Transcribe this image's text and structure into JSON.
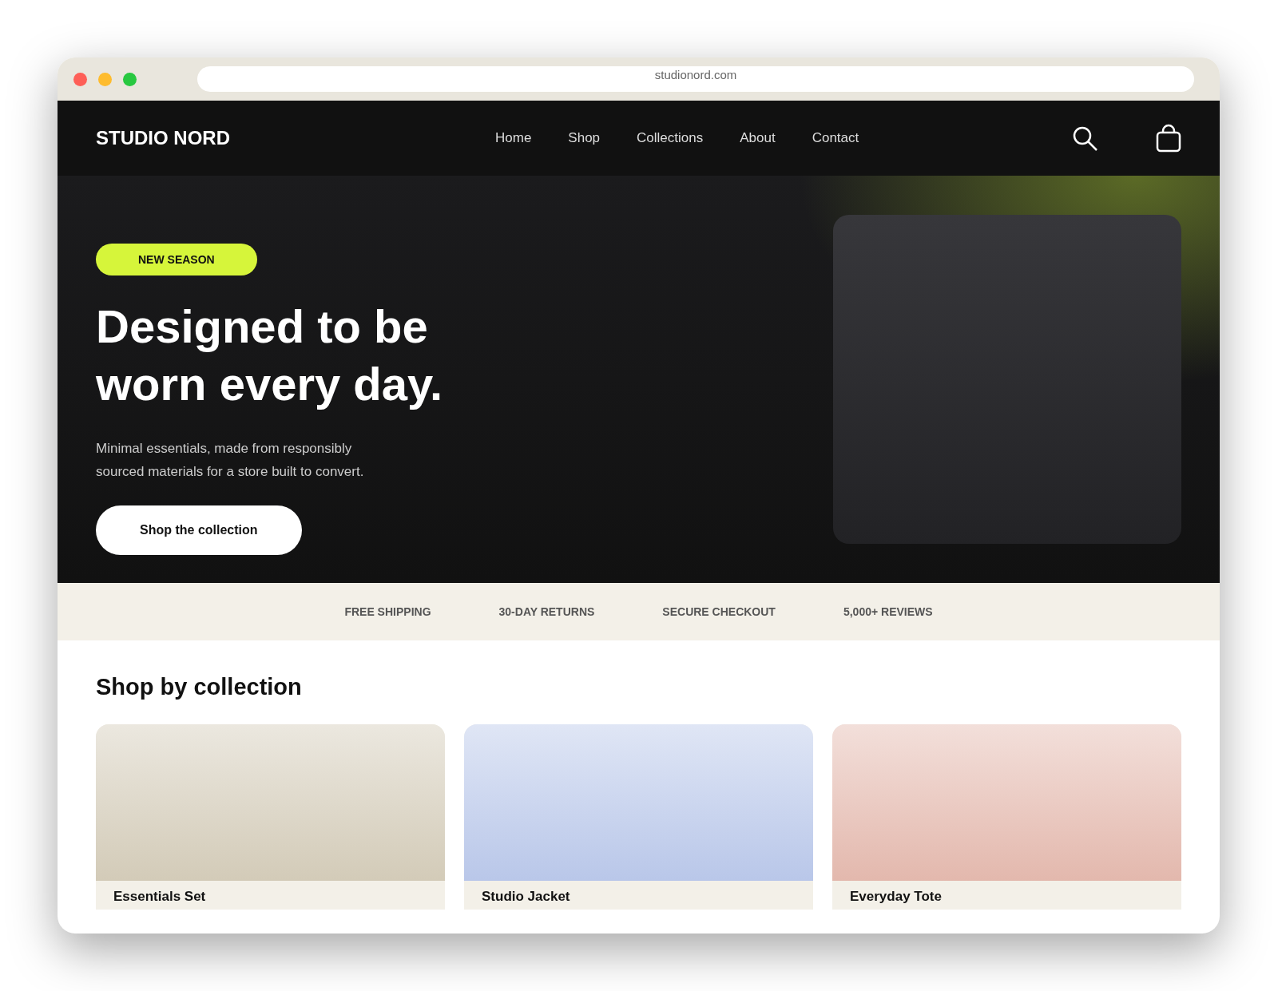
{
  "browser": {
    "url": "studionord.com"
  },
  "nav": {
    "logo": "STUDIO NORD",
    "links": [
      {
        "label": "Home"
      },
      {
        "label": "Shop"
      },
      {
        "label": "Collections"
      },
      {
        "label": "About"
      },
      {
        "label": "Contact"
      }
    ]
  },
  "hero": {
    "badge": "NEW SEASON",
    "title": "Designed to be worn every day.",
    "subtitle": "Minimal essentials, made from responsibly sourced materials for a store built to convert.",
    "button": "Shop the collection"
  },
  "trust_bar": [
    "FREE SHIPPING",
    "30-DAY RETURNS",
    "SECURE CHECKOUT",
    "5,000+ REVIEWS"
  ],
  "collections": {
    "heading": "Shop by collection",
    "cards": [
      {
        "title": "Essentials Set",
        "color": "#d3cbb8"
      },
      {
        "title": "Studio Jacket",
        "color": "#b9c7e9"
      },
      {
        "title": "Everyday Tote",
        "color": "#e3b8ad"
      }
    ]
  }
}
